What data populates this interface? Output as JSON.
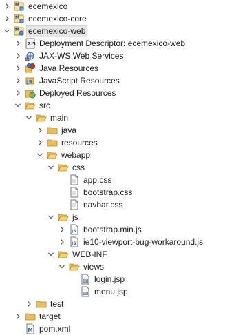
{
  "tree": {
    "nodes": [
      {
        "label": "ecemexico",
        "depth": 0,
        "twisty": "collapsed",
        "icon": "maven-project-icon",
        "row": 0
      },
      {
        "label": "ecemexico-core",
        "depth": 0,
        "twisty": "collapsed",
        "icon": "maven-project-icon",
        "row": 1
      },
      {
        "label": "ecemexico-web",
        "depth": 0,
        "twisty": "expanded",
        "icon": "maven-web-project-icon",
        "row": 2,
        "selected": true
      },
      {
        "label": "Deployment Descriptor: ecemexico-web",
        "depth": 1,
        "twisty": "collapsed",
        "icon": "deployment-descriptor-icon",
        "row": 3
      },
      {
        "label": "JAX-WS Web Services",
        "depth": 1,
        "twisty": "collapsed",
        "icon": "web-services-icon",
        "row": 4
      },
      {
        "label": "Java Resources",
        "depth": 1,
        "twisty": "collapsed",
        "icon": "java-resources-icon",
        "row": 5
      },
      {
        "label": "JavaScript Resources",
        "depth": 1,
        "twisty": "collapsed",
        "icon": "javascript-resources-icon",
        "row": 6
      },
      {
        "label": "Deployed Resources",
        "depth": 1,
        "twisty": "collapsed",
        "icon": "deployed-resources-icon",
        "row": 7
      },
      {
        "label": "src",
        "depth": 1,
        "twisty": "expanded",
        "icon": "folder-open-icon",
        "row": 8
      },
      {
        "label": "main",
        "depth": 2,
        "twisty": "expanded",
        "icon": "folder-open-icon",
        "row": 9
      },
      {
        "label": "java",
        "depth": 3,
        "twisty": "collapsed",
        "icon": "folder-icon",
        "row": 10
      },
      {
        "label": "resources",
        "depth": 3,
        "twisty": "collapsed",
        "icon": "folder-icon",
        "row": 11
      },
      {
        "label": "webapp",
        "depth": 3,
        "twisty": "expanded",
        "icon": "folder-open-icon",
        "row": 12
      },
      {
        "label": "css",
        "depth": 4,
        "twisty": "expanded",
        "icon": "folder-open-icon",
        "row": 13
      },
      {
        "label": "app.css",
        "depth": 5,
        "twisty": "none",
        "icon": "file-icon",
        "row": 14
      },
      {
        "label": "bootstrap.css",
        "depth": 5,
        "twisty": "none",
        "icon": "file-icon",
        "row": 15
      },
      {
        "label": "navbar.css",
        "depth": 5,
        "twisty": "none",
        "icon": "file-icon",
        "row": 16
      },
      {
        "label": "js",
        "depth": 4,
        "twisty": "expanded",
        "icon": "folder-open-icon",
        "row": 17
      },
      {
        "label": "bootstrap.min.js",
        "depth": 5,
        "twisty": "collapsed",
        "icon": "js-file-icon",
        "row": 18
      },
      {
        "label": "ie10-viewport-bug-workaround.js",
        "depth": 5,
        "twisty": "collapsed",
        "icon": "js-file-icon",
        "row": 19
      },
      {
        "label": "WEB-INF",
        "depth": 4,
        "twisty": "expanded",
        "icon": "folder-open-icon",
        "row": 20
      },
      {
        "label": "views",
        "depth": 5,
        "twisty": "expanded",
        "icon": "folder-open-icon",
        "row": 21
      },
      {
        "label": "login.jsp",
        "depth": 6,
        "twisty": "none",
        "icon": "jsp-file-icon",
        "row": 22
      },
      {
        "label": "menu.jsp",
        "depth": 6,
        "twisty": "none",
        "icon": "jsp-file-icon",
        "row": 23
      },
      {
        "label": "test",
        "depth": 2,
        "twisty": "collapsed",
        "icon": "folder-icon",
        "row": 24
      },
      {
        "label": "target",
        "depth": 1,
        "twisty": "collapsed",
        "icon": "folder-icon",
        "row": 25
      },
      {
        "label": "pom.xml",
        "depth": 1,
        "twisty": "none",
        "icon": "maven-pom-icon",
        "row": 26
      }
    ]
  },
  "colors": {
    "folder": "#e8bf5a",
    "folder_dark": "#b98a24",
    "twisty": "#5a5a5a",
    "java": "#b07219",
    "js": "#2b5fa8"
  }
}
